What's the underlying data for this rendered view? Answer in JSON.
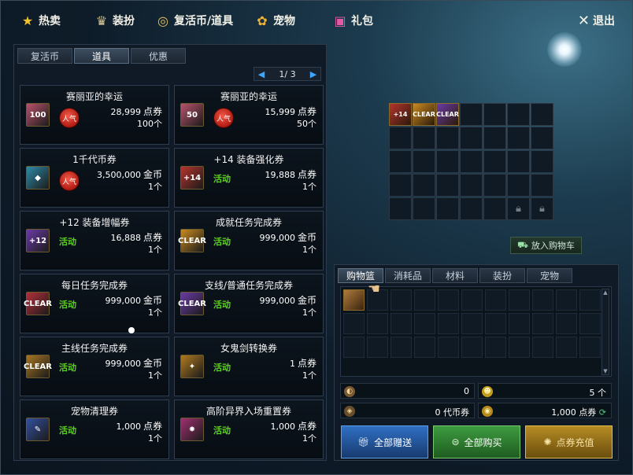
{
  "nav": {
    "hot": "热卖",
    "outfit": "装扮",
    "revive": "复活币/道具",
    "pet": "宠物",
    "gift": "礼包",
    "exit": "退出"
  },
  "left": {
    "tabs": [
      "复活币",
      "道具",
      "优惠"
    ],
    "active_tab": "道具",
    "pager": "1/ 3",
    "items": [
      {
        "title": "赛丽亚的幸运",
        "badge": "人气",
        "price": "28,999",
        "unit": "点券",
        "qty": "100个",
        "thumb_text": "100",
        "thumb_color": "#b8536b"
      },
      {
        "title": "赛丽亚的幸运",
        "badge": "人气",
        "price": "15,999",
        "unit": "点券",
        "qty": "50个",
        "thumb_text": "50",
        "thumb_color": "#b8536b"
      },
      {
        "title": "1千代币券",
        "badge": "人气",
        "price": "3,500,000",
        "unit": "金币",
        "qty": "1个",
        "thumb_text": "◆",
        "thumb_color": "#2e8ba8"
      },
      {
        "title": "+14 装备强化券",
        "badge": "活动",
        "price": "19,888",
        "unit": "点券",
        "qty": "1个",
        "thumb_text": "+14",
        "thumb_color": "#b5342d"
      },
      {
        "title": "+12 装备增幅券",
        "badge": "活动",
        "price": "16,888",
        "unit": "点券",
        "qty": "1个",
        "thumb_text": "+12",
        "thumb_color": "#6b3aa6"
      },
      {
        "title": "成就任务完成券",
        "badge": "活动",
        "price": "999,000",
        "unit": "金币",
        "qty": "1个",
        "thumb_text": "CLEAR",
        "thumb_color": "#c98a1f"
      },
      {
        "title": "每日任务完成券",
        "badge": "活动",
        "price": "999,000",
        "unit": "金币",
        "qty": "1个",
        "thumb_text": "CLEAR",
        "thumb_color": "#b32f3a"
      },
      {
        "title": "支线/普通任务完成券",
        "badge": "活动",
        "price": "999,000",
        "unit": "金币",
        "qty": "1个",
        "thumb_text": "CLEAR",
        "thumb_color": "#6a3aa5"
      },
      {
        "title": "主线任务完成券",
        "badge": "活动",
        "price": "999,000",
        "unit": "金币",
        "qty": "1个",
        "thumb_text": "CLEAR",
        "thumb_color": "#a87622"
      },
      {
        "title": "女鬼剑转换券",
        "badge": "活动",
        "price": "1",
        "unit": "点券",
        "qty": "1个",
        "thumb_text": "✦",
        "thumb_color": "#b07a1f"
      },
      {
        "title": "宠物清理券",
        "badge": "活动",
        "price": "1,000",
        "unit": "点券",
        "qty": "1个",
        "thumb_text": "✎",
        "thumb_color": "#3350a0"
      },
      {
        "title": "高阶异界入场重置券",
        "badge": "活动",
        "price": "1,000",
        "unit": "点券",
        "qty": "1个",
        "thumb_text": "✸",
        "thumb_color": "#a03070"
      }
    ]
  },
  "inventory": {
    "items": [
      {
        "text": "+14",
        "color": "#b5342d"
      },
      {
        "text": "CLEAR",
        "color": "#c98a1f"
      },
      {
        "text": "CLEAR",
        "color": "#6a3aa5"
      }
    ],
    "put_cart_label": "放入购物车"
  },
  "right": {
    "tabs": [
      "购物篮",
      "消耗品",
      "材料",
      "装扮",
      "宠物"
    ],
    "active_tab": "购物篮",
    "summary": {
      "a_value": "0",
      "b_value": "5 个",
      "c_value": "0 代币券",
      "d_value": "1,000 点券"
    },
    "buttons": {
      "gift": "全部赠送",
      "buy": "全部购买",
      "recharge": "点券充值"
    }
  }
}
